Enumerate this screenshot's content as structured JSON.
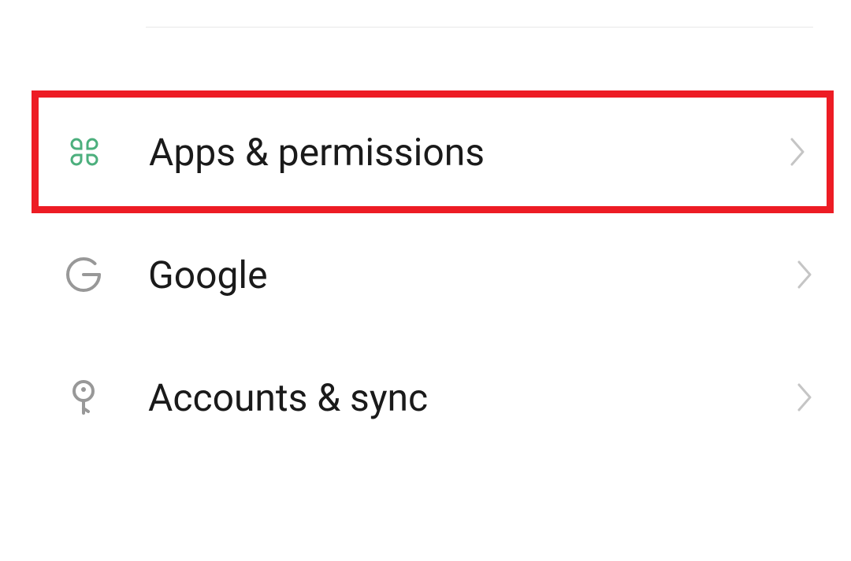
{
  "settings": {
    "items": [
      {
        "label": "Apps & permissions",
        "icon": "apps-icon",
        "highlighted": true
      },
      {
        "label": "Google",
        "icon": "google-icon",
        "highlighted": false
      },
      {
        "label": "Accounts & sync",
        "icon": "key-icon",
        "highlighted": false
      }
    ]
  },
  "colors": {
    "highlight_border": "#ed1c24",
    "apps_icon": "#4caf7d",
    "icon_default": "#989898",
    "chevron": "#c5c5c5"
  }
}
